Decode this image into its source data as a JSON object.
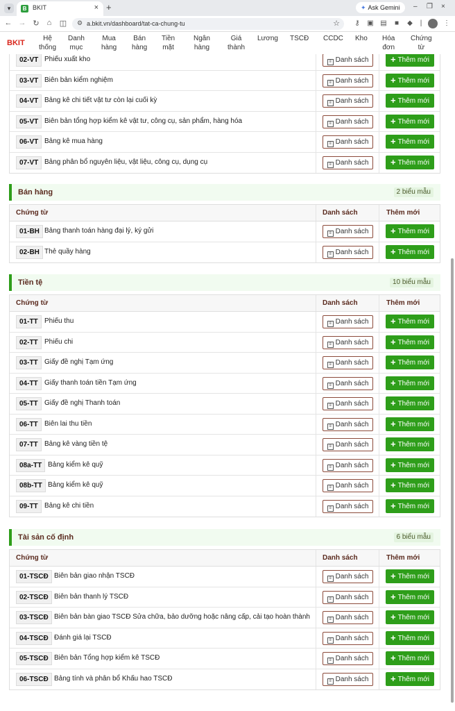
{
  "browser": {
    "tab_title": "BKIT",
    "favicon_letter": "B",
    "url": "a.bkit.vn/dashboard/tat-ca-chung-tu",
    "gemini_label": "Ask Gemini"
  },
  "app": {
    "brand": "BKIT",
    "menu": [
      [
        "Hệ",
        "thống"
      ],
      [
        "Danh",
        "mục"
      ],
      [
        "Mua",
        "hàng"
      ],
      [
        "Bán",
        "hàng"
      ],
      [
        "Tiền",
        "mặt"
      ],
      [
        "Ngân",
        "hàng"
      ],
      [
        "Giá",
        "thành"
      ],
      [
        "Lương",
        ""
      ],
      [
        "TSCĐ",
        ""
      ],
      [
        "CCDC",
        ""
      ],
      [
        "Kho",
        ""
      ],
      [
        "Hóa",
        "đơn"
      ],
      [
        "Chứng",
        "từ"
      ]
    ]
  },
  "labels": {
    "col_doc": "Chứng từ",
    "col_list": "Danh sách",
    "col_add": "Thêm mới",
    "btn_list": "Danh sách",
    "btn_add": "Thêm mới"
  },
  "vattu_rows": [
    {
      "code": "02-VT",
      "name": "Phiếu xuất kho"
    },
    {
      "code": "03-VT",
      "name": "Biên bản kiểm nghiệm"
    },
    {
      "code": "04-VT",
      "name": "Bảng kê chi tiết vật tư còn lại cuối kỳ"
    },
    {
      "code": "05-VT",
      "name": "Biên bản tổng hợp kiểm kê vật tư, công cụ, sản phẩm, hàng hóa"
    },
    {
      "code": "06-VT",
      "name": "Bảng kê mua hàng"
    },
    {
      "code": "07-VT",
      "name": "Bảng phân bổ nguyên liệu, vật liệu, công cụ, dụng cụ"
    }
  ],
  "sections": [
    {
      "title": "Bán hàng",
      "count": "2 biểu mẫu",
      "rows": [
        {
          "code": "01-BH",
          "name": "Bảng thanh toán hàng đại lý, ký gửi"
        },
        {
          "code": "02-BH",
          "name": "Thẻ quầy hàng"
        }
      ]
    },
    {
      "title": "Tiền tệ",
      "count": "10 biểu mẫu",
      "rows": [
        {
          "code": "01-TT",
          "name": "Phiếu thu"
        },
        {
          "code": "02-TT",
          "name": "Phiếu chi"
        },
        {
          "code": "03-TT",
          "name": "Giấy đề nghị Tạm ứng"
        },
        {
          "code": "04-TT",
          "name": "Giấy thanh toán tiền Tạm ứng"
        },
        {
          "code": "05-TT",
          "name": "Giấy đề nghị Thanh toán"
        },
        {
          "code": "06-TT",
          "name": "Biên lai thu tiền"
        },
        {
          "code": "07-TT",
          "name": "Bảng kê vàng tiền tệ"
        },
        {
          "code": "08a-TT",
          "name": "Bảng kiểm kê quỹ"
        },
        {
          "code": "08b-TT",
          "name": "Bảng kiểm kê quỹ"
        },
        {
          "code": "09-TT",
          "name": "Bảng kê chi tiền"
        }
      ]
    },
    {
      "title": "Tài sản cố định",
      "count": "6 biểu mẫu",
      "rows": [
        {
          "code": "01-TSCĐ",
          "name": "Biên bản giao nhận TSCĐ"
        },
        {
          "code": "02-TSCĐ",
          "name": "Biên bản thanh lý TSCĐ"
        },
        {
          "code": "03-TSCĐ",
          "name": "Biên bản bàn giao TSCĐ Sửa chữa, bảo dưỡng hoặc nâng cấp, cải tạo hoàn thành"
        },
        {
          "code": "04-TSCĐ",
          "name": "Đánh giá lại TSCĐ"
        },
        {
          "code": "05-TSCĐ",
          "name": "Biên bản Tổng hợp kiểm kê TSCĐ"
        },
        {
          "code": "06-TSCĐ",
          "name": "Bảng tính và phân bổ Khấu hao TSCĐ"
        }
      ]
    }
  ]
}
